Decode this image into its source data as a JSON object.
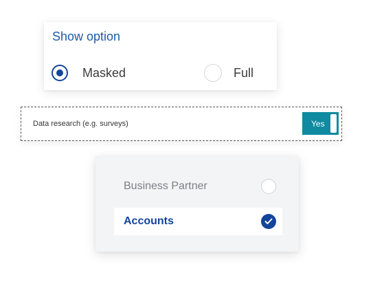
{
  "show_option": {
    "title": "Show option",
    "options": [
      {
        "label": "Masked",
        "selected": true
      },
      {
        "label": "Full",
        "selected": false
      }
    ]
  },
  "consent": {
    "label": "Data research (e.g. surveys)",
    "toggle_label": "Yes",
    "toggle_on": true
  },
  "selection_list": {
    "items": [
      {
        "label": "Business Partner",
        "selected": false
      },
      {
        "label": "Accounts",
        "selected": true
      }
    ]
  },
  "colors": {
    "primary_blue": "#13449a",
    "title_blue": "#1e5aa8",
    "toggle_teal": "#0f8aa0"
  },
  "icons": {
    "radio_selected": "radio-selected-icon",
    "radio_unselected": "radio-unselected-icon",
    "check_selected": "checkmark-circle-icon",
    "check_unselected": "empty-circle-icon"
  }
}
